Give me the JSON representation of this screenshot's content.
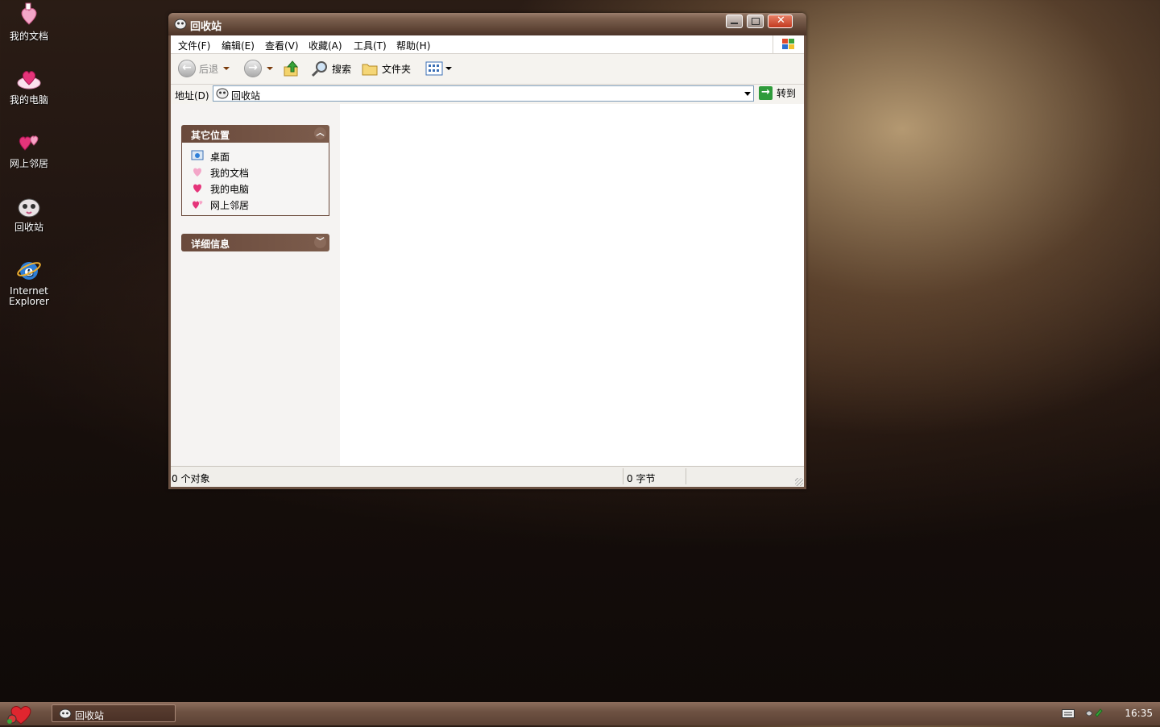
{
  "desktop": {
    "icons": [
      {
        "label": "我的文档"
      },
      {
        "label": "我的电脑"
      },
      {
        "label": "网上邻居"
      },
      {
        "label": "回收站"
      },
      {
        "label_line1": "Internet",
        "label_line2": "Explorer"
      }
    ]
  },
  "window": {
    "title": "回收站",
    "menu": [
      "文件(F)",
      "编辑(E)",
      "查看(V)",
      "收藏(A)",
      "工具(T)",
      "帮助(H)"
    ],
    "toolbar": {
      "back": "后退",
      "search": "搜索",
      "folders": "文件夹"
    },
    "address": {
      "label": "地址(D)",
      "value": "回收站",
      "go": "转到"
    },
    "side_panel": {
      "other_places": {
        "title": "其它位置",
        "items": [
          {
            "label": "桌面"
          },
          {
            "label": "我的文档"
          },
          {
            "label": "我的电脑"
          },
          {
            "label": "网上邻居"
          }
        ]
      },
      "details": {
        "title": "详细信息"
      }
    },
    "status": {
      "objects": "0 个对象",
      "size": "0 字节"
    }
  },
  "taskbar": {
    "task_item": "回收站",
    "clock": "16:35"
  },
  "colors": {
    "title_bar": "#6b5142",
    "pane_header": "#6a4a3c",
    "taskbar": "#6e5243"
  }
}
